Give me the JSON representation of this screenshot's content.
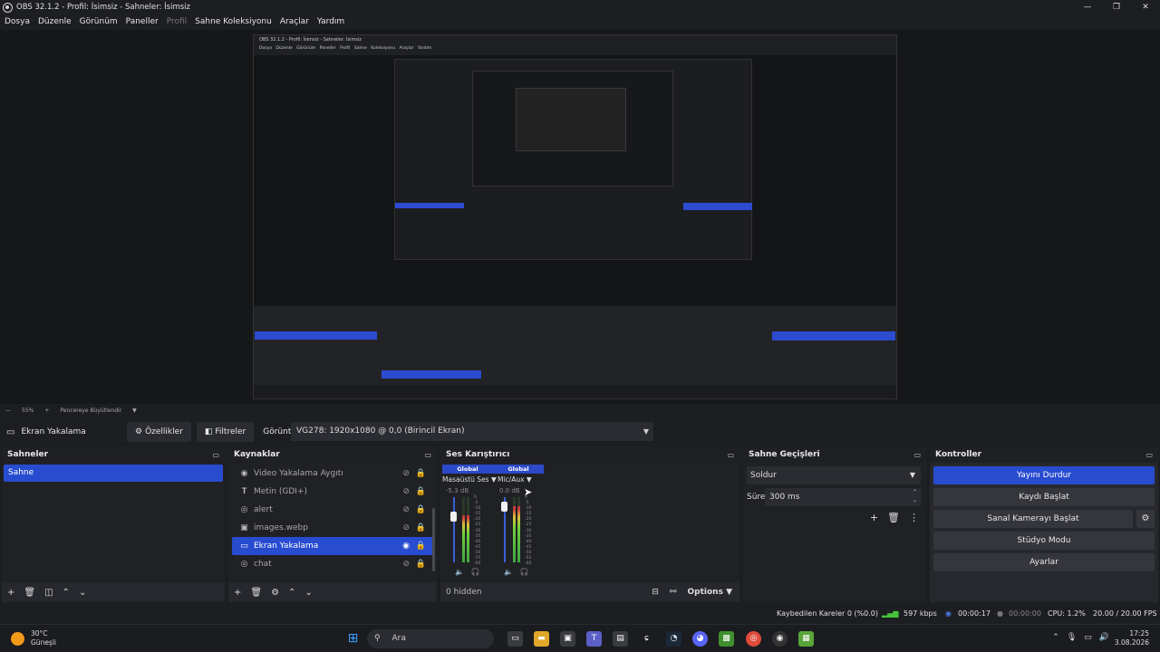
{
  "window": {
    "title": "OBS 32.1.2 - Profil: İsimsiz - Sahneler: İsimsiz",
    "controls": [
      "—",
      "❐",
      "✕"
    ]
  },
  "menu": [
    "Dosya",
    "Düzenle",
    "Görünüm",
    "Paneller",
    "Profil",
    "Sahne Koleksiyonu",
    "Araçlar",
    "Yardım"
  ],
  "zoom": {
    "minus": "—",
    "value": "55%",
    "plus": "+",
    "mode": "Pencereye Büyütlendir"
  },
  "source_bar": {
    "source_name": "Ekran Yakalama",
    "properties_label": "Özellikler",
    "filters_label": "Filtreler",
    "display_label": "Görüntü",
    "display_value": "VG278: 1920x1080 @ 0,0 (Birincil Ekran)"
  },
  "scenes": {
    "title": "Sahneler",
    "items": [
      "Sahne"
    ]
  },
  "sources": {
    "title": "Kaynaklar",
    "items": [
      {
        "name": "Video Yakalama Aygıtı",
        "icon": "camera-icon",
        "visible": false
      },
      {
        "name": "Metin (GDI+)",
        "icon": "text-icon",
        "visible": false
      },
      {
        "name": "alert",
        "icon": "globe-icon",
        "visible": false
      },
      {
        "name": "images.webp",
        "icon": "image-icon",
        "visible": false
      },
      {
        "name": "Ekran Yakalama",
        "icon": "monitor-icon",
        "visible": true
      },
      {
        "name": "chat",
        "icon": "globe-icon",
        "visible": false
      }
    ]
  },
  "mixer": {
    "title": "Ses Karıştırıcı",
    "channels": [
      {
        "badge": "Global",
        "name": "Masaüstü Ses",
        "db": "-5.3 dB",
        "level": 0.72
      },
      {
        "badge": "Global",
        "name": "Mic/Aux",
        "db": "0.0 dB",
        "level": 0.86
      }
    ],
    "scale": [
      "0",
      "-5",
      "-10",
      "-15",
      "-20",
      "-25",
      "-30",
      "-35",
      "-40",
      "-45",
      "-50",
      "-55",
      "-60"
    ],
    "hidden_label": "0 hidden",
    "options_label": "Options"
  },
  "transitions": {
    "title": "Sahne Geçişleri",
    "type": "Soldur",
    "duration_label": "Süre",
    "duration_value": "300 ms"
  },
  "controls": {
    "title": "Kontroller",
    "buttons": [
      "Yayını Durdur",
      "Kaydı Başlat",
      "Sanal Kamerayı Başlat",
      "Stüdyo Modu",
      "Ayarlar"
    ]
  },
  "status": {
    "dropped": "Kaybedilen Kareler 0 (%0.0)",
    "bitrate": "597 kbps",
    "stream_time": "00:00:17",
    "rec_time": "00:00:00",
    "cpu": "CPU: 1.2%",
    "fps": "20.00 / 20.00 FPS"
  },
  "taskbar": {
    "temp": "30°C",
    "weather": "Güneşli",
    "search": "Ara",
    "time": "17:25",
    "date": "3.08.2026"
  },
  "colors": {
    "accent": "#284cd0",
    "background": "#1d1e22",
    "panel": "#27282d"
  }
}
